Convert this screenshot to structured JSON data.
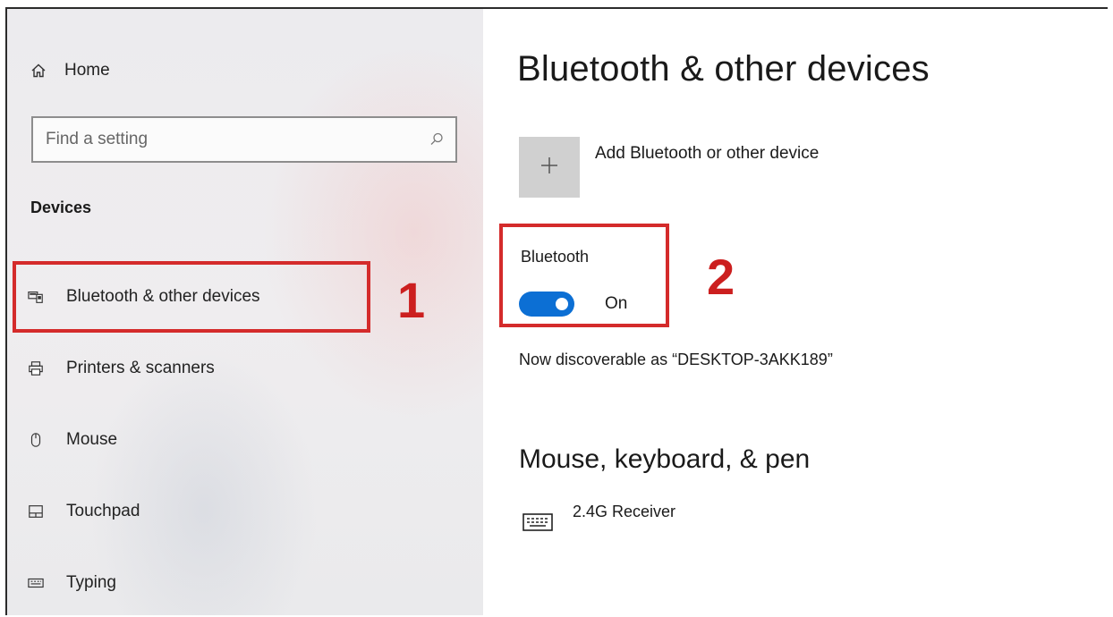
{
  "sidebar": {
    "home_label": "Home",
    "search_placeholder": "Find a setting",
    "section_label": "Devices",
    "items": [
      {
        "label": "Bluetooth & other devices",
        "icon": "bluetooth-devices-icon"
      },
      {
        "label": "Printers & scanners",
        "icon": "printer-icon"
      },
      {
        "label": "Mouse",
        "icon": "mouse-icon"
      },
      {
        "label": "Touchpad",
        "icon": "touchpad-icon"
      },
      {
        "label": "Typing",
        "icon": "keyboard-icon"
      }
    ]
  },
  "main": {
    "title": "Bluetooth & other devices",
    "add_device_label": "Add Bluetooth or other device",
    "bluetooth_label": "Bluetooth",
    "bluetooth_state": "On",
    "discoverable_text": "Now discoverable as “DESKTOP-3AKK189”",
    "section_title": "Mouse, keyboard, & pen",
    "devices": [
      {
        "name": "2.4G Receiver",
        "icon": "keyboard-icon"
      }
    ]
  },
  "annotations": {
    "callout_1": "1",
    "callout_2": "2"
  },
  "colors": {
    "accent": "#0c6fd4",
    "callout_red": "#d42b2b"
  }
}
